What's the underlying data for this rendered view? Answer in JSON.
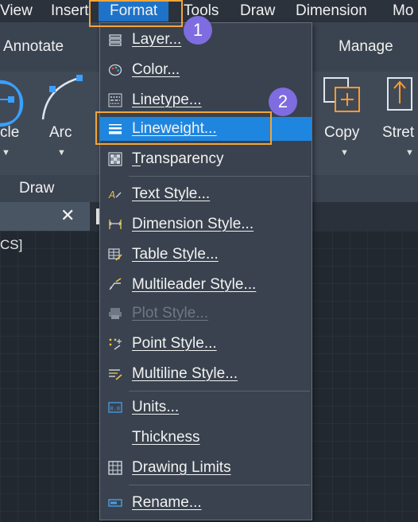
{
  "menubar": {
    "items": [
      "View",
      "Insert",
      "Format",
      "Tools",
      "Draw",
      "Dimension",
      "Mo"
    ],
    "active_index": 2
  },
  "ribbon": {
    "tabs": [
      "Annotate",
      "Manage"
    ],
    "tools": [
      {
        "label": "cle",
        "icon": "circle-icon"
      },
      {
        "label": "Arc",
        "icon": "arc-icon"
      },
      {
        "label": "Copy",
        "icon": "copy-icon"
      },
      {
        "label": "Stret",
        "icon": "stretch-icon"
      }
    ],
    "panel_title": "Draw"
  },
  "file_tab": {
    "close_symbol": "✕"
  },
  "drawing": {
    "ucs_label": "CS]"
  },
  "format_menu": {
    "items": [
      {
        "label": "Layer...",
        "icon": "layer-icon",
        "highlighted": false,
        "disabled": false
      },
      {
        "label": "Color...",
        "icon": "color-palette-icon",
        "highlighted": false,
        "disabled": false
      },
      {
        "label": "Linetype...",
        "icon": "linetype-icon",
        "highlighted": false,
        "disabled": false
      },
      {
        "label": "Lineweight...",
        "icon": "lineweight-icon",
        "highlighted": true,
        "disabled": false
      },
      {
        "label": "Transparency",
        "icon": "transparency-icon",
        "highlighted": false,
        "disabled": false
      },
      {
        "label": "Text Style...",
        "icon": "text-style-icon",
        "highlighted": false,
        "disabled": false
      },
      {
        "label": "Dimension Style...",
        "icon": "dimension-style-icon",
        "highlighted": false,
        "disabled": false
      },
      {
        "label": "Table Style...",
        "icon": "table-style-icon",
        "highlighted": false,
        "disabled": false
      },
      {
        "label": "Multileader Style...",
        "icon": "multileader-style-icon",
        "highlighted": false,
        "disabled": false
      },
      {
        "label": "Plot Style...",
        "icon": "plot-style-icon",
        "highlighted": false,
        "disabled": true
      },
      {
        "label": "Point Style...",
        "icon": "point-style-icon",
        "highlighted": false,
        "disabled": false
      },
      {
        "label": "Multiline Style...",
        "icon": "multiline-style-icon",
        "highlighted": false,
        "disabled": false
      },
      {
        "label": "Units...",
        "icon": "units-icon",
        "highlighted": false,
        "disabled": false
      },
      {
        "label": "Thickness",
        "icon": "",
        "highlighted": false,
        "disabled": false
      },
      {
        "label": "Drawing Limits",
        "icon": "drawing-limits-icon",
        "highlighted": false,
        "disabled": false
      },
      {
        "label": "Rename...",
        "icon": "rename-icon",
        "highlighted": false,
        "disabled": false
      }
    ]
  },
  "callouts": [
    {
      "number": "1"
    },
    {
      "number": "2"
    }
  ],
  "colors": {
    "accent_highlight": "#1f86e0",
    "callout_border": "#f2a53a",
    "badge": "#7e6ce0",
    "menu_bg": "#39424e"
  }
}
